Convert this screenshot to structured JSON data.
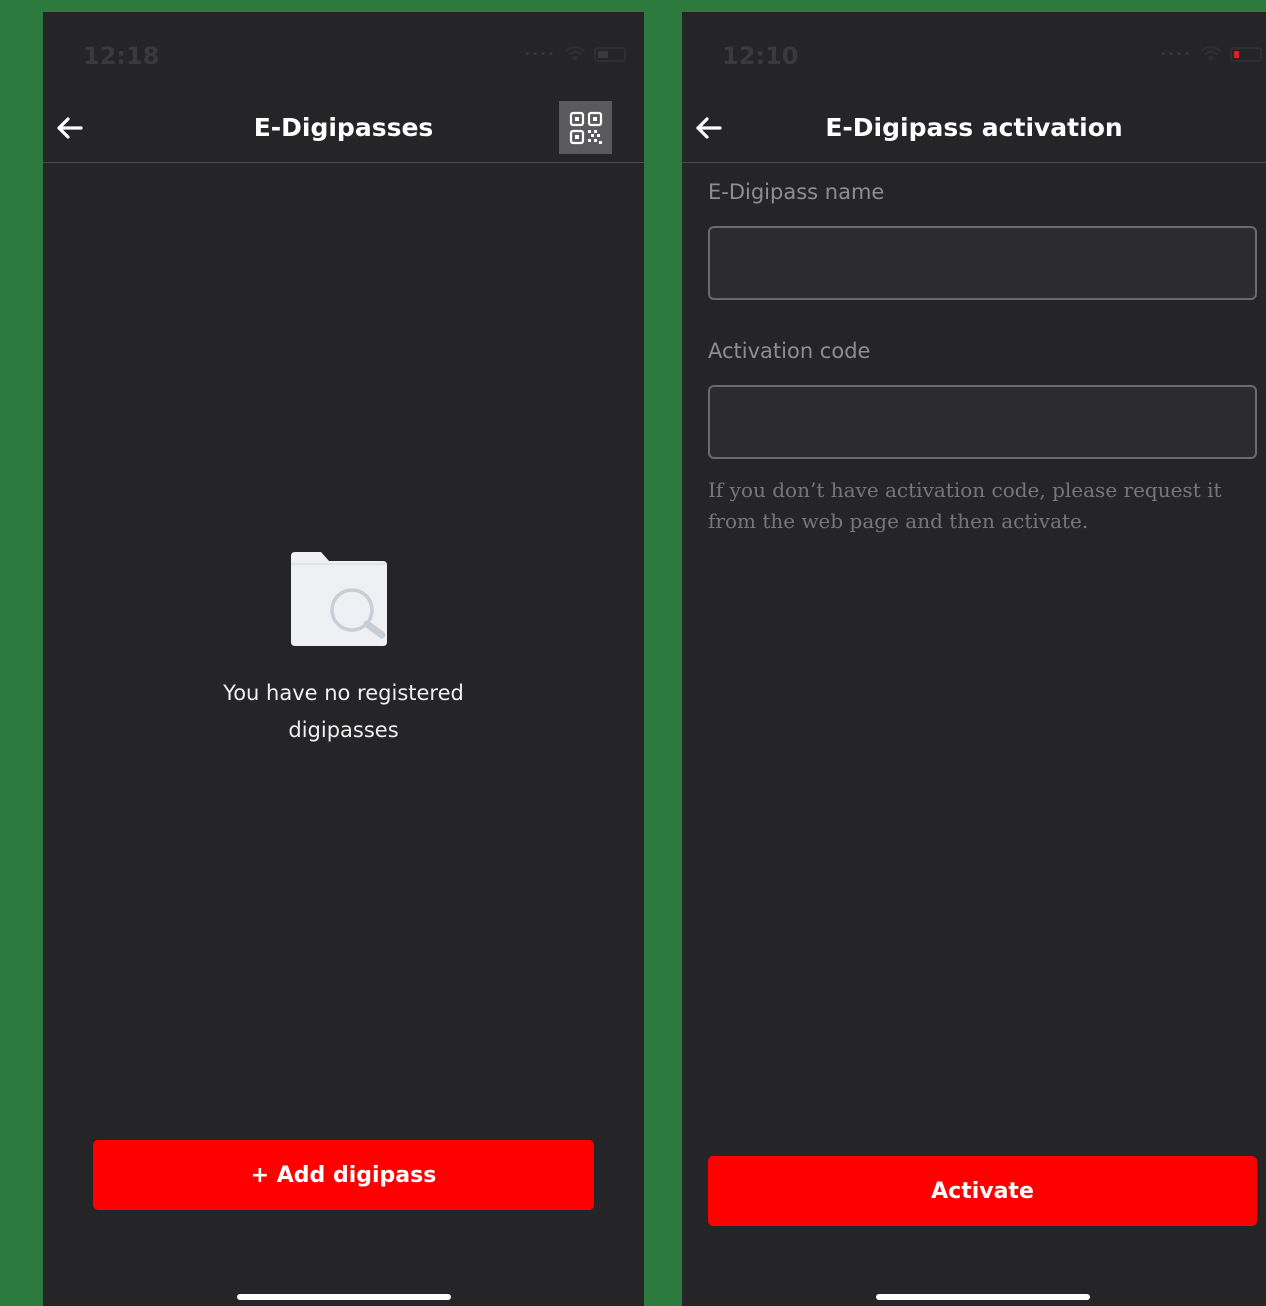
{
  "left_screen": {
    "status": {
      "time": "12:18"
    },
    "nav": {
      "title": "E-Digipasses"
    },
    "empty_message": "You have no registered digipasses",
    "add_button_label": "+ Add digipass"
  },
  "right_screen": {
    "status": {
      "time": "12:10"
    },
    "nav": {
      "title": "E-Digipass activation"
    },
    "fields": [
      {
        "label": "E-Digipass name",
        "value": ""
      },
      {
        "label": "Activation code",
        "value": ""
      }
    ],
    "help_text": "If you don’t have activation code, please request it from the web page and then activate.",
    "activate_button_label": "Activate"
  },
  "icons": {
    "back": "arrow-left-icon",
    "qr": "qr-code-icon",
    "empty": "folder-search-icon",
    "wifi": "wifi-icon",
    "battery": "battery-icon"
  },
  "colors": {
    "background": "#2d7a3e",
    "screen": "#252527",
    "accent": "#ff0000",
    "battery_low": "#e02020"
  }
}
